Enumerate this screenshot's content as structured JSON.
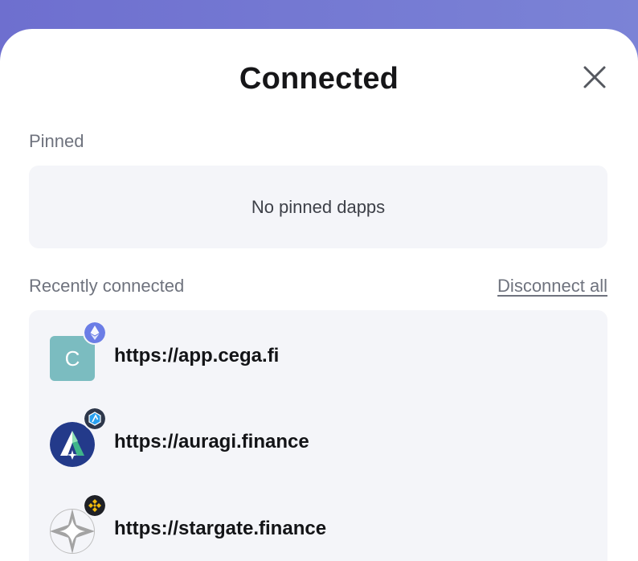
{
  "modal": {
    "title": "Connected",
    "close_icon": "close-icon"
  },
  "pinned": {
    "label": "Pinned",
    "empty_text": "No pinned dapps"
  },
  "recent": {
    "label": "Recently connected",
    "disconnect_all_label": "Disconnect all",
    "items": [
      {
        "url": "https://app.cega.fi",
        "icon_letter": "C",
        "icon": "letter-avatar",
        "icon_color": "#7bbcc0",
        "chain_icon": "ethereum-icon"
      },
      {
        "url": "https://auragi.finance",
        "icon": "auragi-logo-icon",
        "icon_color": "#233a8a",
        "chain_icon": "arbitrum-icon"
      },
      {
        "url": "https://stargate.finance",
        "icon": "stargate-logo-icon",
        "icon_color": "#9a9a9a",
        "chain_icon": "bnb-chain-icon"
      }
    ]
  },
  "colors": {
    "background_gradient_start": "#6e6fcf",
    "background_gradient_end": "#7b83d6",
    "sheet": "#ffffff",
    "card": "#f4f5f9",
    "muted_text": "#6f737e"
  }
}
